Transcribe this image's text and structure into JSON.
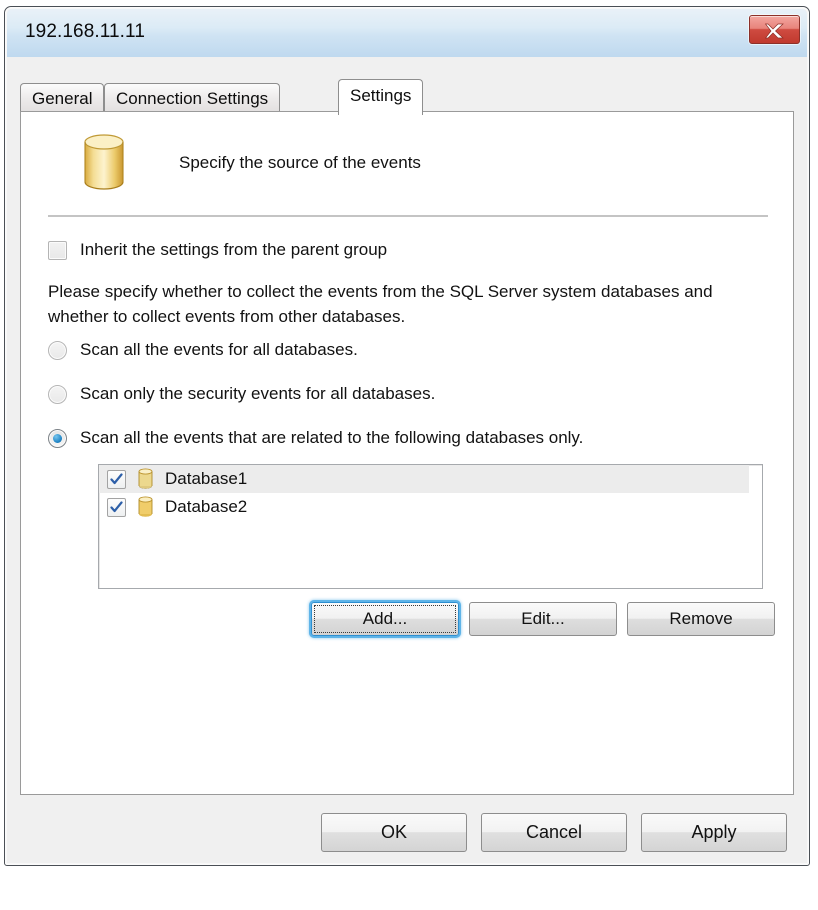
{
  "window": {
    "title": "192.168.11.11",
    "close_label": "Close"
  },
  "tabs": [
    {
      "label": "General",
      "active": false
    },
    {
      "label": "Connection Settings",
      "active": false
    },
    {
      "label": "Settings",
      "active": true
    }
  ],
  "panel": {
    "header_caption": "Specify the source of the events",
    "header_icon": "database-cylinder-icon",
    "inherit_checkbox": {
      "label": "Inherit the settings from the parent group",
      "checked": false,
      "enabled": false
    },
    "description": "Please specify whether to collect the events from the SQL Server system databases and whether to collect events from other databases.",
    "radio_options": [
      {
        "label": "Scan all the events for all databases.",
        "selected": false
      },
      {
        "label": "Scan only the security events for all databases.",
        "selected": false
      },
      {
        "label": "Scan all the events that are related to the following databases only.",
        "selected": true
      }
    ],
    "database_list": [
      {
        "name": "Database1",
        "checked": true,
        "selected": true,
        "icon": "database-cylinder-icon"
      },
      {
        "name": "Database2",
        "checked": true,
        "selected": false,
        "icon": "database-cylinder-icon"
      }
    ],
    "list_buttons": [
      {
        "label": "Add...",
        "focused": true
      },
      {
        "label": "Edit...",
        "focused": false
      },
      {
        "label": "Remove",
        "focused": false
      }
    ]
  },
  "dialog_buttons": [
    {
      "label": "OK"
    },
    {
      "label": "Cancel"
    },
    {
      "label": "Apply"
    }
  ],
  "colors": {
    "titlebar_top": "#e9f1f8",
    "titlebar_bottom": "#bfd9ef",
    "close_button_red": "#c0392e",
    "accent_blue": "#1a7fc1",
    "focus_glow": "#5fb4e8",
    "selection_gray": "#ececec",
    "db_icon_gold": "#e3b84a"
  }
}
